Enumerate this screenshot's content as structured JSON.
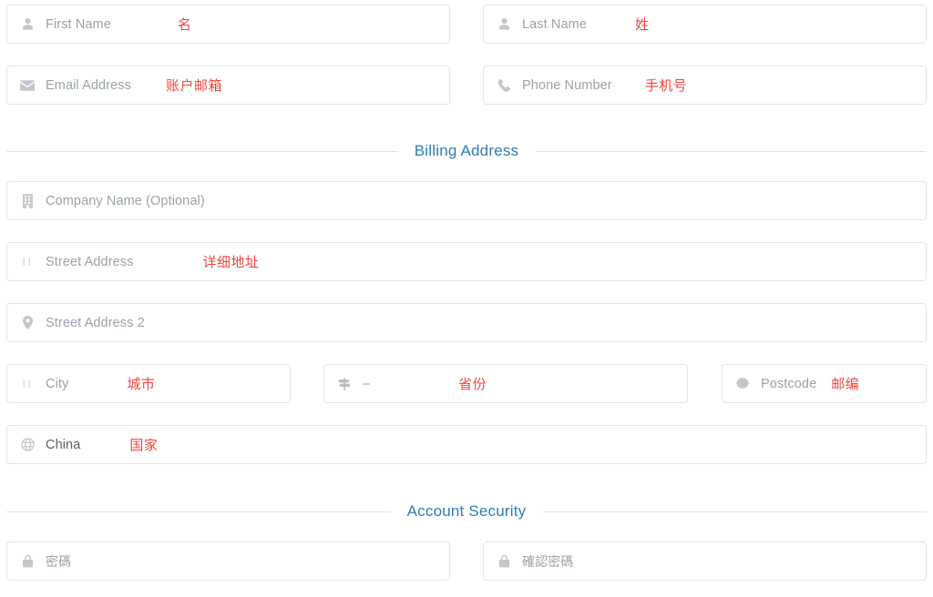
{
  "theme": {
    "accent": "#2d7db5",
    "annotation_color": "#f2453d",
    "placeholder_color": "#9aa2ab",
    "border_color": "#e4e6e8",
    "background": "#ffffff"
  },
  "fields": {
    "first_name": {
      "placeholder": "First Name",
      "annotation": "名",
      "icon": "user-icon",
      "value": ""
    },
    "last_name": {
      "placeholder": "Last Name",
      "annotation": "姓",
      "icon": "user-icon",
      "value": ""
    },
    "email": {
      "placeholder": "Email Address",
      "annotation": "账户邮箱",
      "icon": "envelope-icon",
      "value": ""
    },
    "phone": {
      "placeholder": "Phone Number",
      "annotation": "手机号",
      "icon": "phone-icon",
      "value": ""
    },
    "company": {
      "placeholder": "Company Name (Optional)",
      "annotation": "",
      "icon": "building-icon",
      "value": ""
    },
    "street": {
      "placeholder": "Street Address",
      "annotation": "详细地址",
      "icon": "road-icon",
      "value": ""
    },
    "street2": {
      "placeholder": "Street Address 2",
      "annotation": "",
      "icon": "map-marker-icon",
      "value": ""
    },
    "city": {
      "placeholder": "City",
      "annotation": "城市",
      "icon": "road-icon",
      "value": ""
    },
    "province": {
      "placeholder": "–",
      "annotation": "省份",
      "icon": "signpost-icon",
      "value": ""
    },
    "postcode": {
      "placeholder": "Postcode",
      "annotation": "邮编",
      "icon": "badge-icon",
      "value": ""
    },
    "country": {
      "placeholder": "China",
      "annotation": "国家",
      "icon": "globe-icon",
      "value": "China"
    },
    "password": {
      "placeholder": "密碼",
      "annotation": "",
      "icon": "lock-icon",
      "value": ""
    },
    "confirm_password": {
      "placeholder": "確認密碼",
      "annotation": "",
      "icon": "lock-icon",
      "value": ""
    }
  },
  "sections": {
    "billing": {
      "title": "Billing Address"
    },
    "security": {
      "title": "Account Security"
    }
  }
}
